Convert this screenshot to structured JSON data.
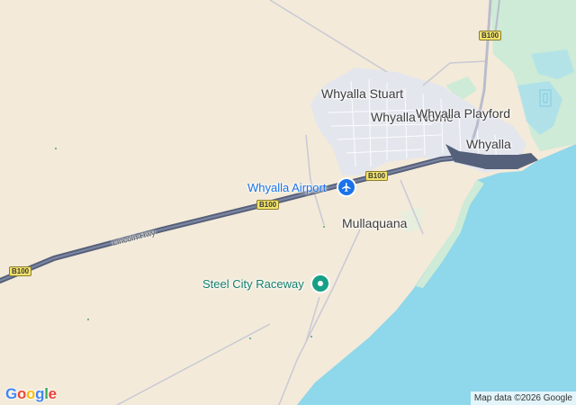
{
  "map": {
    "places": {
      "whyalla_stuart": "Whyalla Stuart",
      "whyalla_norrie": "Whyalla Norrie",
      "whyalla_playford": "Whyalla Playford",
      "whyalla": "Whyalla",
      "mullaquana": "Mullaquana"
    },
    "pois": {
      "airport": "Whyalla Airport",
      "raceway": "Steel City Raceway"
    },
    "roads": {
      "highway_name": "Lincoln Hwy",
      "route_shield": "B100"
    },
    "colors": {
      "land": "#f3ead9",
      "water": "#8fd7ea",
      "park": "#cdebd6",
      "urban": "#e4e6ee",
      "highway": "#55607a",
      "airport_marker": "#1a73e8",
      "raceway_marker": "#17a085"
    }
  },
  "branding": {
    "logo": "Google",
    "attribution": "Map data ©2026 Google"
  }
}
